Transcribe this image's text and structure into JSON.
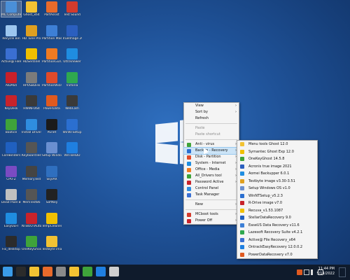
{
  "desktop": {
    "icons": [
      {
        "label": "MC Computer",
        "icon": "computer-icon",
        "color": "#4a8fd8"
      },
      {
        "label": "Ghost_x64",
        "icon": "ghost-icon",
        "color": "#f2c233"
      },
      {
        "label": "PartAssist",
        "icon": "partition-icon",
        "color": "#e86a2b"
      },
      {
        "label": "Test Sound",
        "icon": "sound-icon",
        "color": "#d33b2c"
      },
      {
        "label": "Recycle Bin",
        "icon": "recycle-bin-icon",
        "color": "#9cc6ef"
      },
      {
        "label": "HD Tune Pro",
        "icon": "hdtune-icon",
        "color": "#e0a020"
      },
      {
        "label": "Partition Master",
        "icon": "partition-master-icon",
        "color": "#3d7fd6"
      },
      {
        "label": "TrueImage 2021",
        "icon": "trueimage-icon",
        "color": "#2b5fbf"
      },
      {
        "label": "Active@ FileRecovery",
        "icon": "file-recovery-icon",
        "color": "#3a6fd2"
      },
      {
        "label": "HDSentinel",
        "icon": "hdsentinel-icon",
        "color": "#f0c000"
      },
      {
        "label": "PartitionGuru",
        "icon": "partitionguru-icon",
        "color": "#f07b21"
      },
      {
        "label": "UltraViewer",
        "icon": "ultraviewer-icon",
        "color": "#1f8de0"
      },
      {
        "label": "AIDA64",
        "icon": "aida64-icon",
        "color": "#c8202a"
      },
      {
        "label": "HPUSBDisk",
        "icon": "usb-icon",
        "color": "#7b7b7b"
      },
      {
        "label": "PartitionWizard",
        "icon": "partitionwizard-icon",
        "color": "#e04a2a"
      },
      {
        "label": "Victoria",
        "icon": "victoria-icon",
        "color": "#2fa84f"
      },
      {
        "label": "KeyDesk",
        "icon": "keydesk-icon",
        "color": "#c8232b"
      },
      {
        "label": "HWiNFO64",
        "icon": "hwinfo-icon",
        "color": "#3a3a3a"
      },
      {
        "label": "PowerData",
        "icon": "powerdata-icon",
        "color": "#e05a20"
      },
      {
        "label": "WebCam",
        "icon": "webcam-icon",
        "color": "#3a3a3a"
      },
      {
        "label": "Bootice",
        "icon": "bootice-icon",
        "color": "#3fa33a"
      },
      {
        "label": "Install Driver",
        "icon": "install-driver-icon",
        "color": "#2f8ddf"
      },
      {
        "label": "PEnet",
        "icon": "penet-icon",
        "color": "#1b1b1b"
      },
      {
        "label": "WinNTSetup",
        "icon": "winntsetup-icon",
        "color": "#2b6fd0"
      },
      {
        "label": "CoreBinders",
        "icon": "corebinders-icon",
        "color": "#2060c0"
      },
      {
        "label": "KeyboardTest",
        "icon": "keyboard-icon",
        "color": "#555555"
      },
      {
        "label": "Setup Windows OS",
        "icon": "setup-windows-icon",
        "color": "#6a8fd0"
      },
      {
        "label": "WinToHDD",
        "icon": "wintohdd-icon",
        "color": "#1f7fe0"
      },
      {
        "label": "CPU-Z",
        "icon": "cpuz-icon",
        "color": "#7a4bc2"
      },
      {
        "label": "MemoryTest",
        "icon": "memtest-icon",
        "color": "#444444"
      },
      {
        "label": "SkyIAR",
        "icon": "skyiar-icon",
        "color": "#2f6fbf"
      },
      {
        "label": "",
        "icon": "blank-icon",
        "color": "#1f5298"
      },
      {
        "label": "Dead Pixel Buddy",
        "icon": "dead-pixel-icon",
        "color": "#c0c0c0"
      },
      {
        "label": "MemTest86",
        "icon": "memtest86-icon",
        "color": "#555555"
      },
      {
        "label": "SoftKey",
        "icon": "softkey-icon",
        "color": "#222222"
      },
      {
        "label": "",
        "icon": "blank-icon",
        "color": "#1f5298"
      },
      {
        "label": "EasyUEFI",
        "icon": "easyuefi-icon",
        "color": "#1f8de0"
      },
      {
        "label": "NTBOOTAutofix",
        "icon": "ntboot-icon",
        "color": "#c8232b"
      },
      {
        "label": "TempCleaner",
        "icon": "tempcleaner-icon",
        "color": "#f0c000"
      },
      {
        "label": "",
        "icon": "blank-icon",
        "color": "#1f5298"
      },
      {
        "label": "Fix_desktop",
        "icon": "fix-desktop-icon",
        "color": "#2b2b2b"
      },
      {
        "label": "OneKeyGhost",
        "icon": "onekeyghost-icon",
        "color": "#3fa33a"
      },
      {
        "label": "TestByte image",
        "icon": "testbyte-icon",
        "color": "#f2c233"
      }
    ]
  },
  "context_menu": {
    "items": [
      {
        "label": "View",
        "arrow": "›",
        "type": "item",
        "icon_color": ""
      },
      {
        "label": "Sort by",
        "arrow": "›",
        "type": "item",
        "icon_color": ""
      },
      {
        "label": "Refresh",
        "arrow": "",
        "type": "item",
        "icon_color": ""
      },
      {
        "type": "sep"
      },
      {
        "label": "Paste",
        "arrow": "",
        "type": "disabled",
        "icon_color": ""
      },
      {
        "label": "Paste shortcut",
        "arrow": "",
        "type": "disabled",
        "icon_color": ""
      },
      {
        "type": "sep"
      },
      {
        "label": "Anti - virus",
        "arrow": "›",
        "type": "item",
        "icon_color": "#3fa33a"
      },
      {
        "label": "Backup - Recovery",
        "arrow": "›",
        "type": "hl",
        "icon_color": "#2b6fd0"
      },
      {
        "label": "Disk - Partition",
        "arrow": "›",
        "type": "item",
        "icon_color": "#e04a2a"
      },
      {
        "label": "System - Internet",
        "arrow": "›",
        "type": "item",
        "icon_color": "#1f8de0"
      },
      {
        "label": "Office - Media",
        "arrow": "›",
        "type": "item",
        "icon_color": "#f07b21"
      },
      {
        "label": "All_Drivers tool",
        "arrow": "›",
        "type": "item",
        "icon_color": "#3fa33a"
      },
      {
        "label": "Password Active",
        "arrow": "›",
        "type": "item",
        "icon_color": "#c8232b"
      },
      {
        "label": "Control Panel",
        "arrow": "",
        "type": "item",
        "icon_color": "#2f8ddf"
      },
      {
        "label": "Task Manager",
        "arrow": "",
        "type": "item",
        "icon_color": "#3a6fd2"
      },
      {
        "type": "sep"
      },
      {
        "label": "New",
        "arrow": "›",
        "type": "item",
        "icon_color": ""
      },
      {
        "type": "sep"
      },
      {
        "label": "MCboot tools",
        "arrow": "›",
        "type": "item",
        "icon_color": "#d33b2c"
      },
      {
        "label": "Power Off",
        "arrow": "›",
        "type": "item",
        "icon_color": "#c8232b"
      }
    ]
  },
  "submenu": {
    "items": [
      {
        "label": "Menu tools Ghost 12.0",
        "icon_color": "#f2c233"
      },
      {
        "label": "Symantec Ghost Exp 12.0",
        "icon_color": "#f0c000"
      },
      {
        "label": "OneKeyGhost 14.5.8",
        "icon_color": "#3fa33a"
      },
      {
        "label": "Acronis true image 2021",
        "icon_color": "#2b5fbf"
      },
      {
        "label": "Aomei Backupper 6.0.1",
        "icon_color": "#1f8de0"
      },
      {
        "label": "Testbyte image v3.30-3.51",
        "icon_color": "#e0a020"
      },
      {
        "label": "Setup Windows OS v1.0",
        "icon_color": "#6a8fd0"
      },
      {
        "label": "WinNTSetup_v5.2.3",
        "icon_color": "#2b6fd0"
      },
      {
        "label": "R-Drive image v7.0",
        "icon_color": "#c8232b"
      },
      {
        "label": "Recuva_v1.53.1087",
        "icon_color": "#f0c000"
      },
      {
        "label": "StellarDataRecovery 9.0",
        "icon_color": "#2060c0"
      },
      {
        "label": "EaseUS Data Recovery v11.6",
        "icon_color": "#3d7fd6"
      },
      {
        "label": "Lazesoft Recovery Suite v4.2.1",
        "icon_color": "#2fa84f"
      },
      {
        "label": "Active@ File Recovery_x64",
        "icon_color": "#3a6fd2"
      },
      {
        "label": "OntrackEasyRecovery 12.0.0.2",
        "icon_color": "#1f7fe0"
      },
      {
        "label": "PowerDataRecovery v7.0",
        "icon_color": "#e05a20"
      }
    ]
  },
  "taskbar": {
    "buttons": [
      {
        "icon": "start-icon",
        "color": "#3a9be8"
      },
      {
        "icon": "cmd-icon",
        "color": "#2b2b2b"
      },
      {
        "icon": "explorer-icon",
        "color": "#f2c233"
      },
      {
        "icon": "partition-icon",
        "color": "#e86a2b"
      },
      {
        "icon": "app-icon",
        "color": "#8a8a8a"
      },
      {
        "icon": "ghost-icon",
        "color": "#f2c233"
      },
      {
        "icon": "onekeyghost-icon",
        "color": "#3fa33a"
      },
      {
        "icon": "wintohdd-icon",
        "color": "#1f7fe0"
      },
      {
        "icon": "memtest-icon",
        "color": "#cfcfcf"
      }
    ],
    "time": "11:44 PM",
    "date": "5/14/2022"
  }
}
